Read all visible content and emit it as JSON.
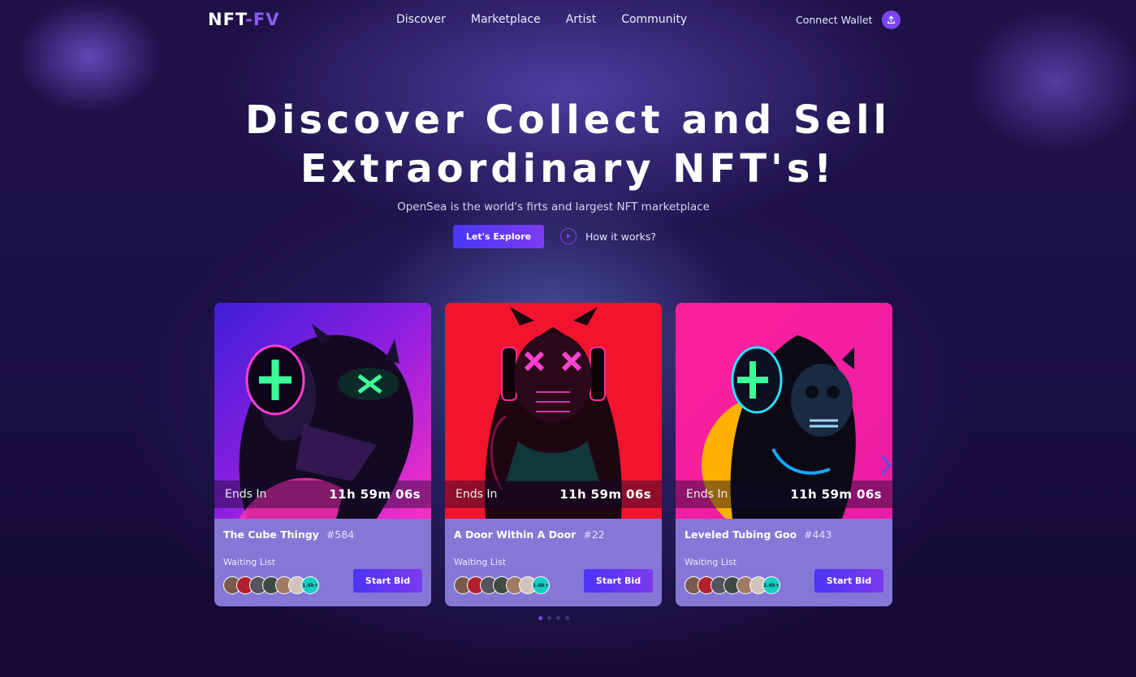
{
  "brand": {
    "part1": "NFT",
    "part2": "-FV"
  },
  "nav": {
    "links": [
      "Discover",
      "Marketplace",
      "Artist",
      "Community"
    ],
    "connect_label": "Connect Wallet",
    "upload_icon": "upload-icon"
  },
  "hero": {
    "title_line1": "Discover Collect and Sell",
    "title_line2": "Extraordinary NFT's!",
    "subtitle": "OpenSea is the world's firts and largest NFT marketplace",
    "explore_label": "Let's Explore",
    "how_label": "How it works?"
  },
  "cards": [
    {
      "ends_label": "Ends In",
      "time": "11h 59m 06s",
      "name": "The Cube Thingy",
      "number": "#584",
      "waiting_label": "Waiting List",
      "more_count": "1.6k+",
      "bid_label": "Start Bid",
      "bg": "#8a2be2"
    },
    {
      "ends_label": "Ends In",
      "time": "11h 59m 06s",
      "name": "A Door Within A Door",
      "number": "#22",
      "waiting_label": "Waiting List",
      "more_count": "1.6k+",
      "bid_label": "Start Bid",
      "bg": "#ff1a3d"
    },
    {
      "ends_label": "Ends In",
      "time": "11h 59m 06s",
      "name": "Leveled Tubing Goo",
      "number": "#443",
      "waiting_label": "Waiting List",
      "more_count": "1.6k+",
      "bid_label": "Start Bid",
      "bg": "#ff1fa2"
    }
  ],
  "colors": {
    "accent": "#7b46f0",
    "card_body": "#8577d6",
    "avatar_more": "#19cdc4"
  },
  "carousel": {
    "slides": 4,
    "active": 0
  }
}
